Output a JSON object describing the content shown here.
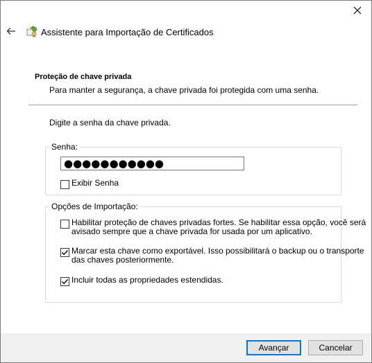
{
  "window": {
    "title": "Assistente para Importação de Certificados",
    "close_icon": "close-icon",
    "back_icon": "back-arrow-icon",
    "app_icon": "certificate-icon"
  },
  "header": {
    "section_title": "Proteção de chave privada",
    "section_description": "Para manter a segurança, a chave privada foi protegida com uma senha."
  },
  "body": {
    "prompt": "Digite a senha da chave privada.",
    "password_group": {
      "legend": "Senha:",
      "value": "●●●●●●●●●●●",
      "show_password_label": "Exibir Senha",
      "show_password_checked": false
    },
    "options_group": {
      "legend": "Opções de Importação:",
      "options": [
        {
          "label_line1": "Habilitar proteção de chaves privadas fortes. Se habilitar essa opção, você será",
          "label_line2": "avisado sempre que a chave privada for usada por um aplicativo.",
          "checked": false
        },
        {
          "label_line1": "Marcar esta chave como exportável. Isso possibilitará o backup ou o transporte",
          "label_line2": "das chaves posteriormente.",
          "checked": true
        },
        {
          "label_line1": "Incluir todas as propriedades estendidas.",
          "label_line2": "",
          "checked": true
        }
      ]
    }
  },
  "footer": {
    "next_label": "Avançar",
    "cancel_label": "Cancelar"
  },
  "colors": {
    "accent": "#0078d7",
    "footer_bg": "#f0f0f0",
    "button_bg": "#e1e1e1"
  }
}
